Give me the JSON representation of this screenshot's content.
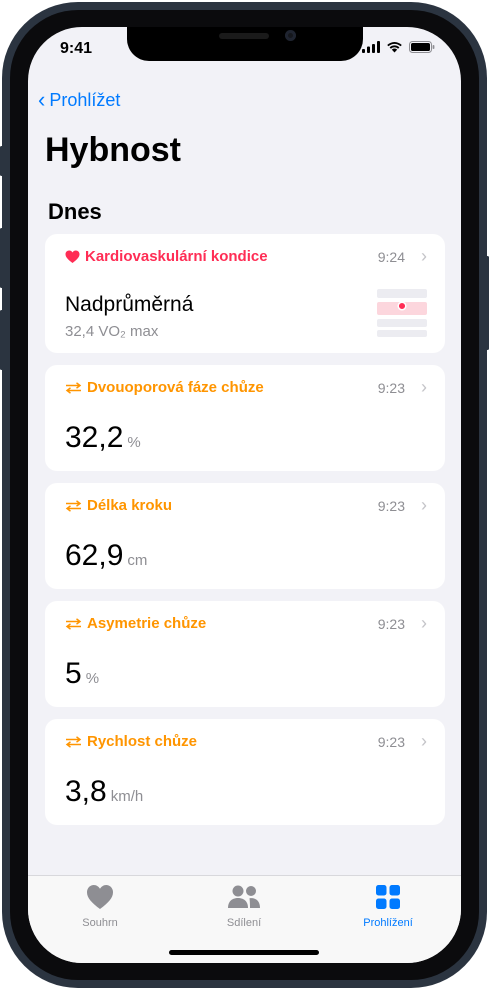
{
  "status": {
    "time": "9:41"
  },
  "nav": {
    "back_label": "Prohlížet"
  },
  "page": {
    "title": "Hybnost",
    "section": "Dnes"
  },
  "colors": {
    "accent": "#007aff",
    "orange": "#ff9500",
    "pink": "#ff2d55"
  },
  "cards": [
    {
      "title": "Kardiovaskulární kondice",
      "time": "9:24",
      "value": "Nadprůměrná",
      "sub": "32,4 VO₂ max"
    },
    {
      "title": "Dvouoporová fáze chůze",
      "time": "9:23",
      "value": "32,2",
      "unit": "%"
    },
    {
      "title": "Délka kroku",
      "time": "9:23",
      "value": "62,9",
      "unit": "cm"
    },
    {
      "title": "Asymetrie chůze",
      "time": "9:23",
      "value": "5",
      "unit": "%"
    },
    {
      "title": "Rychlost chůze",
      "time": "9:23",
      "value": "3,8",
      "unit": "km/h"
    }
  ],
  "tabs": [
    {
      "label": "Souhrn",
      "icon": "heart-icon"
    },
    {
      "label": "Sdílení",
      "icon": "people-icon"
    },
    {
      "label": "Prohlížení",
      "icon": "grid-icon"
    }
  ]
}
